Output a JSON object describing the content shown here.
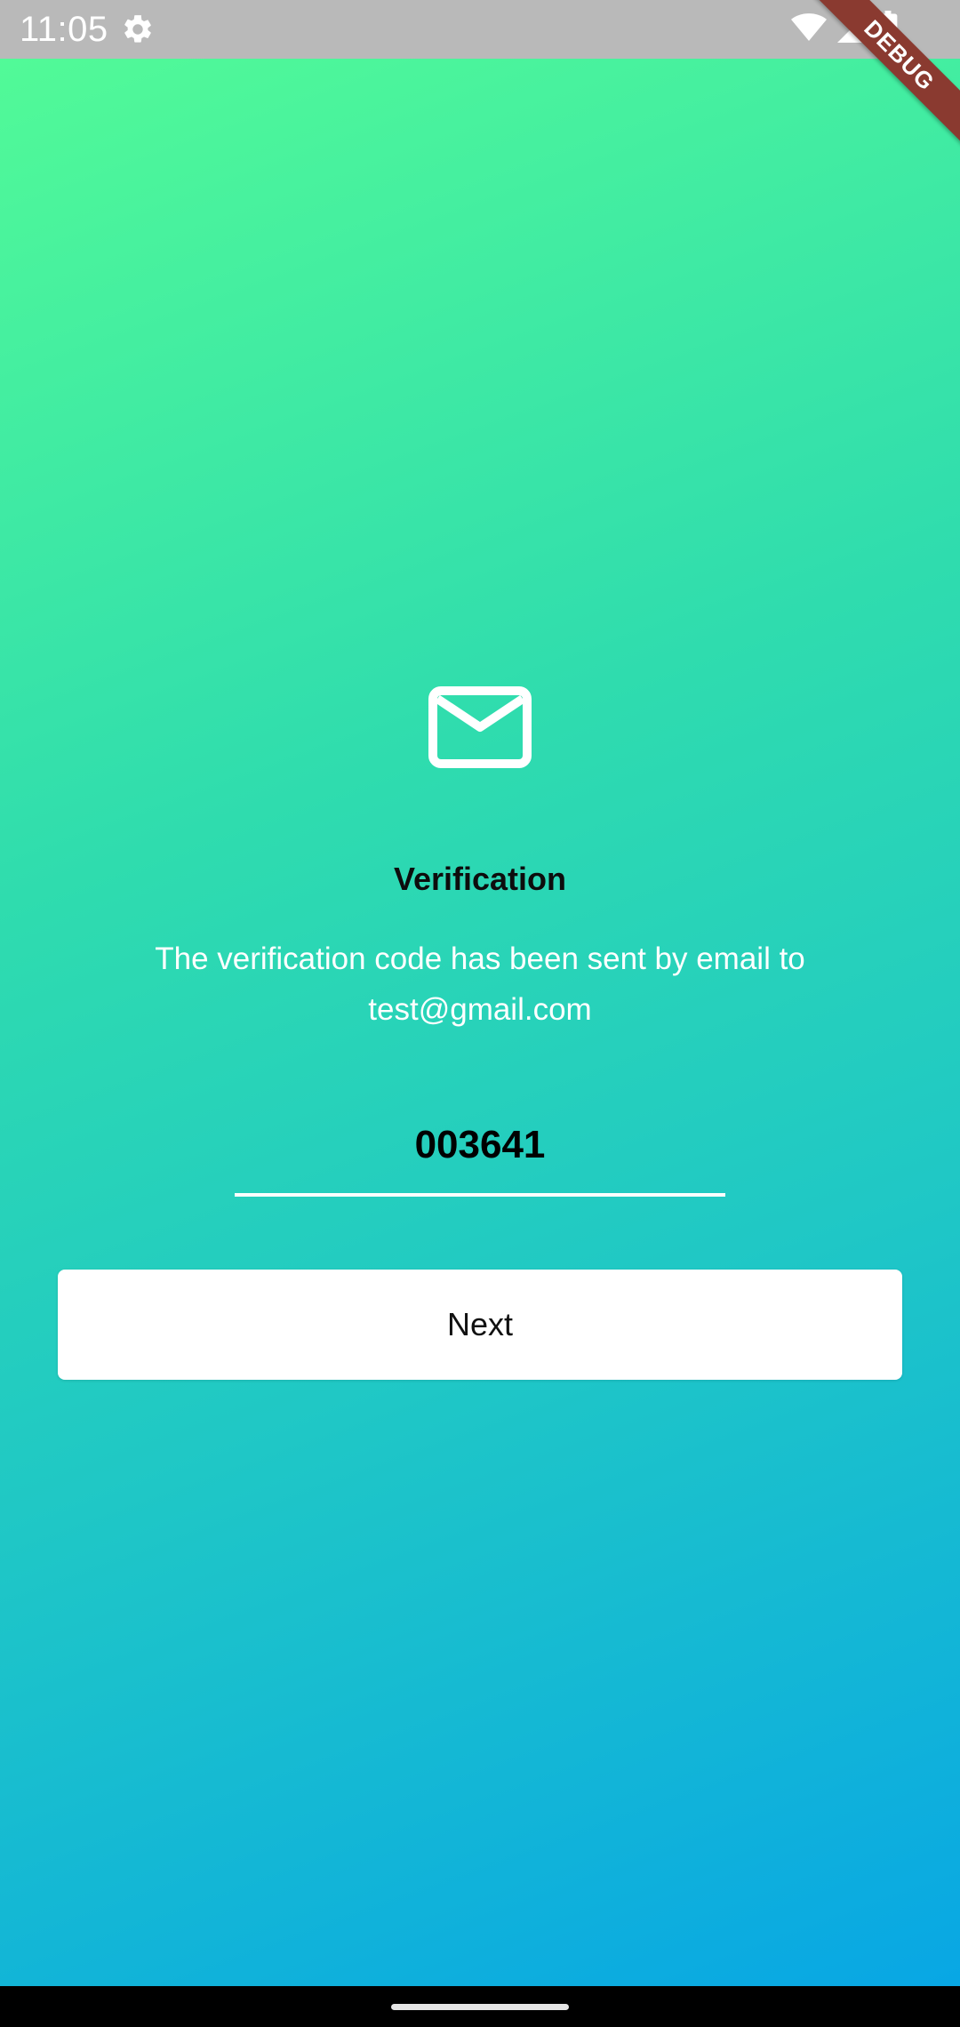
{
  "status_bar": {
    "time": "11:05",
    "icons": [
      "gear-icon",
      "wifi-icon",
      "signal-icon",
      "battery-icon"
    ]
  },
  "debug_banner": {
    "label": "DEBUG"
  },
  "verification": {
    "icon": "mail-icon",
    "title": "Verification",
    "message": "The verification code has been sent by email to test@gmail.com",
    "code_value": "003641",
    "next_label": "Next"
  },
  "colors": {
    "gradient_start": "#54fc96",
    "gradient_end": "#07a5e6",
    "button_bg": "#ffffff",
    "debug_ribbon": "#8a3a30"
  }
}
